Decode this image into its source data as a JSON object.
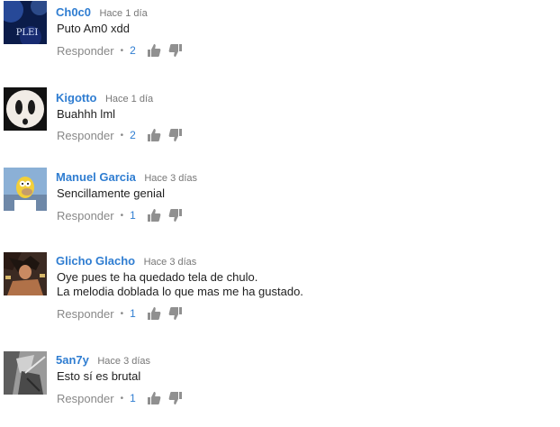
{
  "comments": [
    {
      "author": "Ch0c0",
      "time": "Hace 1 día",
      "text": [
        "Puto Am0 xdd"
      ],
      "reply_label": "Responder",
      "likes": "2",
      "avatar_text": "PLEI"
    },
    {
      "author": "Kigotto",
      "time": "Hace 1 día",
      "text": [
        "Buahhh lml"
      ],
      "reply_label": "Responder",
      "likes": "2"
    },
    {
      "author": "Manuel Garcia",
      "time": "Hace 3 días",
      "text": [
        "Sencillamente genial"
      ],
      "reply_label": "Responder",
      "likes": "1"
    },
    {
      "author": "Glicho Glacho",
      "time": "Hace 3 días",
      "text": [
        "Oye pues te ha quedado tela de chulo.",
        "La melodia doblada lo que mas me ha gustado."
      ],
      "reply_label": "Responder",
      "likes": "1"
    },
    {
      "author": "5an7y",
      "time": "Hace 3 días",
      "text": [
        "Esto sí es brutal"
      ],
      "reply_label": "Responder",
      "likes": "1"
    }
  ],
  "colors": {
    "author": "#2f7dd1",
    "likes": "#2f7dd1",
    "meta": "#888888",
    "text": "#222222",
    "icon": "#909090"
  },
  "icons": {
    "like": "thumbs-up-icon",
    "dislike": "thumbs-down-icon",
    "separator": "•"
  }
}
